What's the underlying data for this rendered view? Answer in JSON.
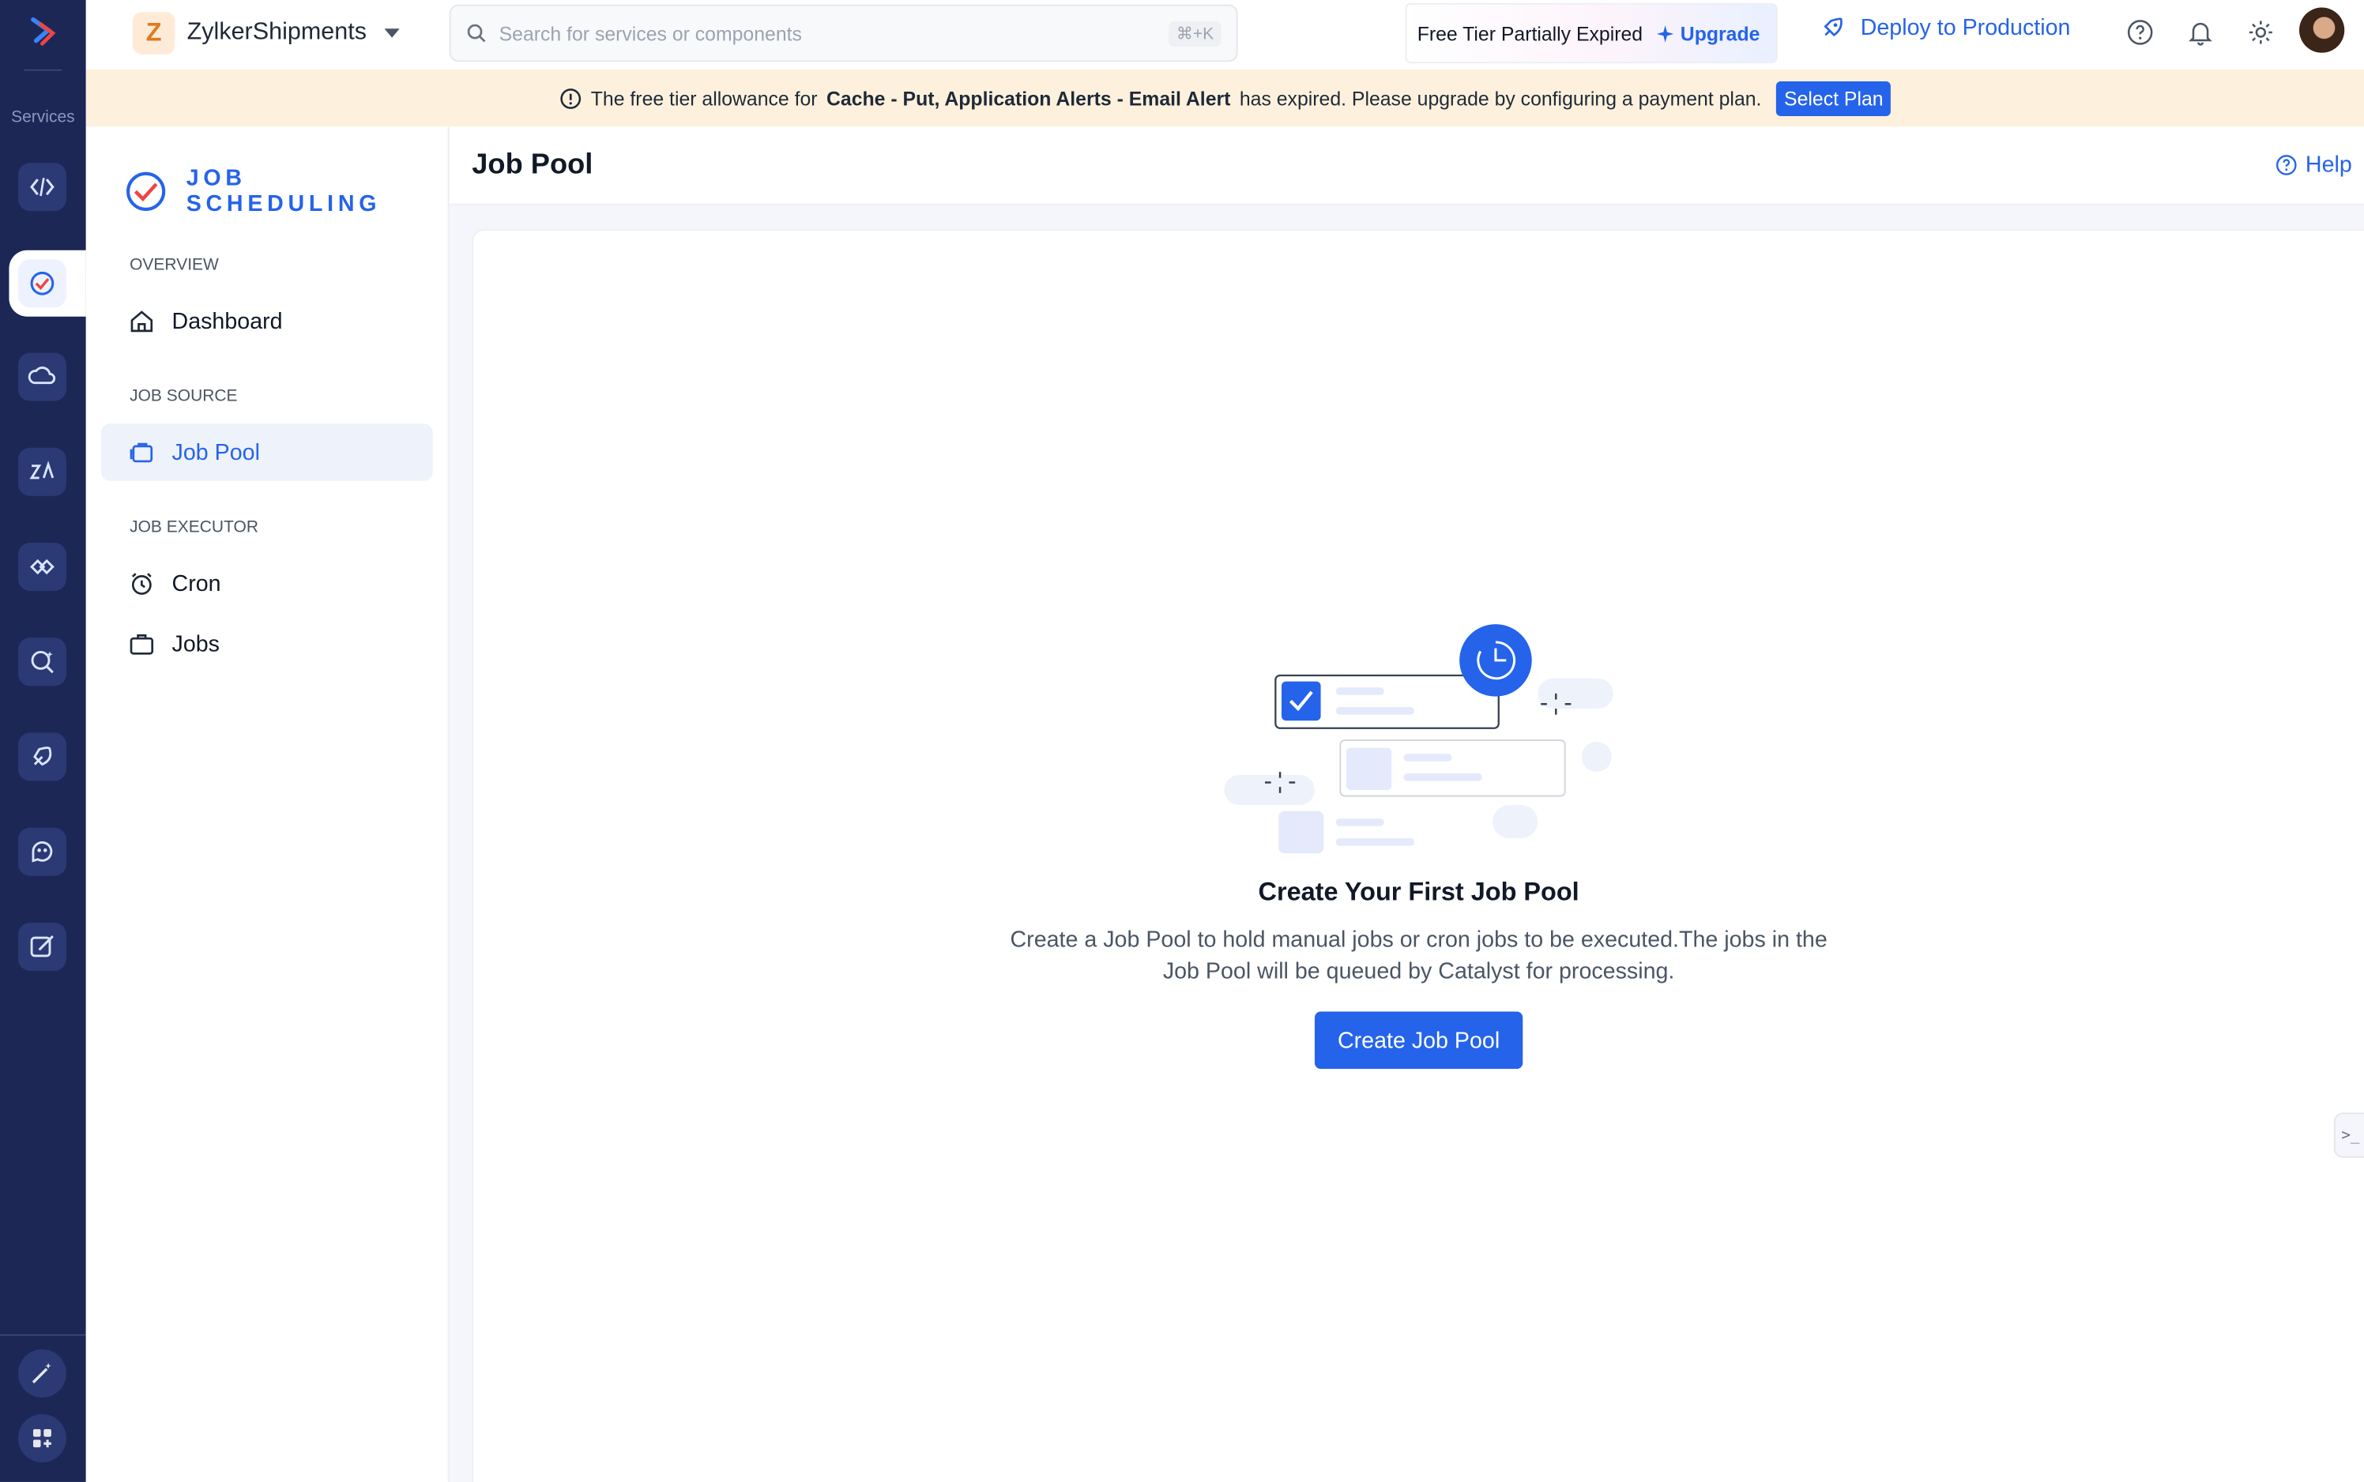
{
  "rail": {
    "caption": "Services",
    "active_item": "job-scheduling"
  },
  "topbar": {
    "project_initial": "Z",
    "project_name": "ZylkerShipments",
    "search_placeholder": "Search for services or components",
    "search_shortcut": "⌘+K",
    "tier_status": "Free Tier Partially Expired",
    "upgrade_label": "Upgrade",
    "deploy_label": "Deploy to Production"
  },
  "banner": {
    "prefix": "The free tier allowance for",
    "services": "Cache - Put, Application Alerts - Email Alert",
    "suffix": "has expired. Please upgrade by configuring a payment plan.",
    "button": "Select Plan"
  },
  "sidebar": {
    "brand": "JOB SCHEDULING",
    "sections": {
      "overview": "OVERVIEW",
      "job_source": "JOB SOURCE",
      "job_executor": "JOB EXECUTOR"
    },
    "items": {
      "dashboard": "Dashboard",
      "job_pool": "Job Pool",
      "cron": "Cron",
      "jobs": "Jobs"
    }
  },
  "main": {
    "title": "Job Pool",
    "help": "Help",
    "empty_title": "Create Your First Job Pool",
    "empty_desc": "Create a Job Pool to hold manual jobs or cron jobs to be executed.The jobs in the Job Pool will be queued by Catalyst for processing.",
    "create_button": "Create Job Pool",
    "side_tab": ">_"
  },
  "colors": {
    "rail": "#1c2756",
    "accent": "#2563eb",
    "banner": "#fdf1dd",
    "active_nav": "#eef2fb"
  }
}
